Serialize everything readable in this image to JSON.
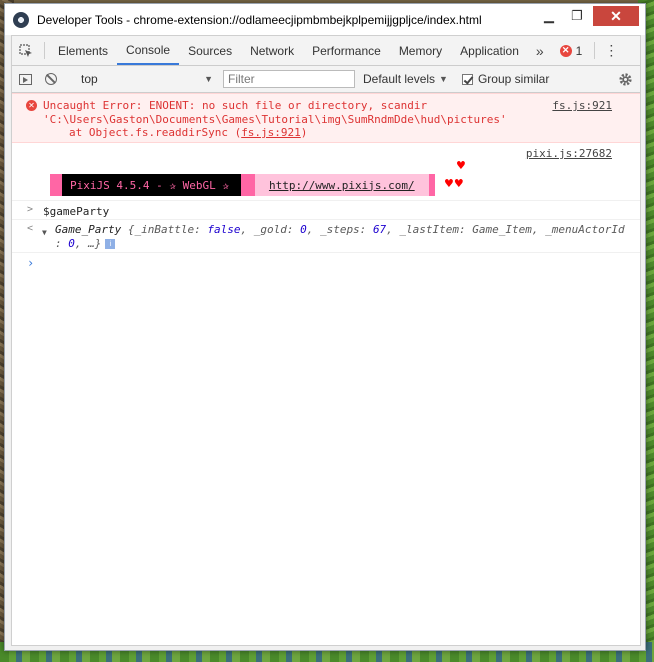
{
  "window": {
    "title": "Developer Tools - chrome-extension://odlameecjipmbmbejkplpemijjgpljce/index.html",
    "controls": {
      "minimize": "▁",
      "restore": "❐",
      "close": "✕"
    }
  },
  "tabs": [
    {
      "label": "Elements"
    },
    {
      "label": "Console"
    },
    {
      "label": "Sources"
    },
    {
      "label": "Network"
    },
    {
      "label": "Performance"
    },
    {
      "label": "Memory"
    },
    {
      "label": "Application"
    }
  ],
  "tabbar": {
    "more": "»",
    "error_count": "1",
    "error_glyph": "✕",
    "kebab": "⋮"
  },
  "toolbar": {
    "context": "top",
    "filter_placeholder": "Filter",
    "levels": "Default levels",
    "group_similar": "Group similar",
    "caret": "▼"
  },
  "console": {
    "error": {
      "line1": "Uncaught Error: ENOENT: no such file or directory, scandir",
      "line2": "'C:\\Users\\Gaston\\Documents\\Games\\Tutorial\\img\\SumRndmDde\\hud\\pictures'",
      "line3_prefix": "at Object.fs.readdirSync (",
      "line3_link": "fs.js:921",
      "line3_suffix": ")",
      "source": "fs.js:921",
      "icon": "✕"
    },
    "pixi": {
      "source": "pixi.js:27682",
      "banner_text": "PixiJS 4.5.4 - ✰ WebGL ✰",
      "banner_link": "http://www.pixijs.com/",
      "hearts": [
        "♥",
        "♥♥"
      ]
    },
    "command": {
      "caret": ">",
      "text": "$gameParty"
    },
    "result": {
      "caret": "<",
      "triangle": "▼",
      "class_name": "Game_Party",
      "line1_props": "{_inBattle: ",
      "inBattle": "false",
      "gold_label": ", _gold: ",
      "gold": "0",
      "steps_label": ", _steps: ",
      "steps": "67",
      "lastItem_label": ", _lastItem: Game_Item, _menuActorId",
      "line2_prefix": ": ",
      "menuActorId": "0",
      "line2_suffix": ", …}",
      "info_badge": "i"
    },
    "prompt_caret": "›"
  }
}
